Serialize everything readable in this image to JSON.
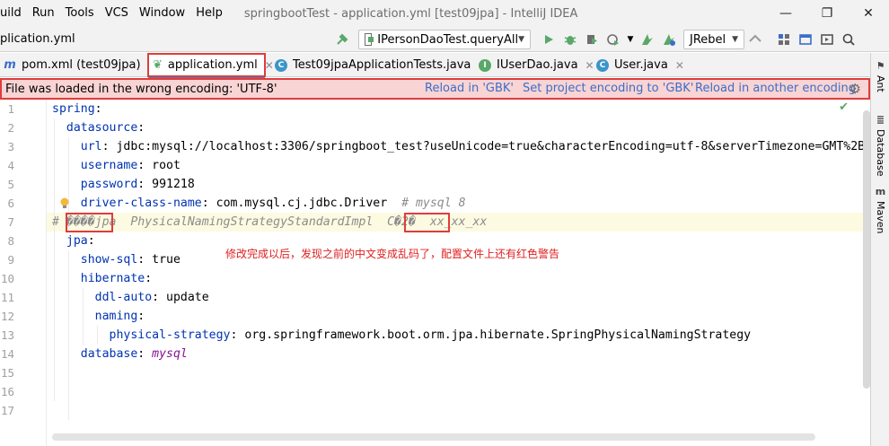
{
  "window": {
    "title": "springbootTest - application.yml [test09jpa] - IntelliJ IDEA",
    "controls": [
      "—",
      "❐",
      "✕"
    ]
  },
  "menu": [
    "uild",
    "Run",
    "Tools",
    "VCS",
    "Window",
    "Help"
  ],
  "breadcrumb": "plication.yml",
  "toolbar": {
    "run_config": "IPersonDaoTest.queryAll",
    "jrebel": "JRebel"
  },
  "tabs": [
    {
      "label": "pom.xml (test09jpa)",
      "icon": "maven-icon",
      "icon_char": "m",
      "icon_color": "#3c6ec8",
      "active": false
    },
    {
      "label": "application.yml",
      "icon": "spring-leaf-icon",
      "icon_char": "❦",
      "icon_color": "#59a869",
      "active": true
    },
    {
      "label": "Test09jpaApplicationTests.java",
      "icon": "class-icon",
      "icon_char": "C",
      "icon_color": "#3a95c9",
      "active": false
    },
    {
      "label": "IUserDao.java",
      "icon": "interface-icon",
      "icon_char": "I",
      "icon_color": "#59a869",
      "active": false
    },
    {
      "label": "User.java",
      "icon": "class-icon",
      "icon_char": "C",
      "icon_color": "#3a95c9",
      "active": false
    }
  ],
  "banner": {
    "message": "File was loaded in the wrong encoding: 'UTF-8'",
    "actions": [
      "Reload in 'GBK'",
      "Set project encoding to 'GBK'",
      "Reload in another encoding"
    ]
  },
  "right_tools": [
    "Ant",
    "Database",
    "Maven"
  ],
  "editor": {
    "line_numbers": [
      "1",
      "2",
      "3",
      "4",
      "5",
      "6",
      "7",
      "8",
      "9",
      "10",
      "11",
      "12",
      "13",
      "14",
      "15",
      "16",
      "17"
    ],
    "lines": [
      {
        "key": "spring",
        "sep": ":",
        "val": "",
        "comment": ""
      },
      {
        "key": "  datasource",
        "sep": ":",
        "val": "",
        "comment": ""
      },
      {
        "key": "    url",
        "sep": ": ",
        "val": "jdbc:mysql://localhost:3306/springboot_test?useUnicode=true&characterEncoding=utf-8&serverTimezone=GMT%2B",
        "comment": ""
      },
      {
        "key": "    username",
        "sep": ": ",
        "val": "root",
        "comment": ""
      },
      {
        "key": "    password",
        "sep": ": ",
        "val": "991218",
        "comment": ""
      },
      {
        "key": "    driver-class-name",
        "sep": ": ",
        "val": "com.mysql.cj.jdbc.Driver",
        "comment": "  # mysql 8"
      },
      {
        "key": "",
        "sep": "",
        "val": "",
        "comment": "# ����jpa  PhysicalNamingStrategyStandardImpl  C�2�  xx_xx_xx"
      },
      {
        "key": "  jpa",
        "sep": ":",
        "val": "",
        "comment": ""
      },
      {
        "key": "    show-sql",
        "sep": ": ",
        "val": "true",
        "comment": ""
      },
      {
        "key": "    hibernate",
        "sep": ":",
        "val": "",
        "comment": ""
      },
      {
        "key": "      ddl-auto",
        "sep": ": ",
        "val": "update",
        "comment": ""
      },
      {
        "key": "      naming",
        "sep": ":",
        "val": "",
        "comment": ""
      },
      {
        "key": "        physical-strategy",
        "sep": ": ",
        "val": "org.springframework.boot.orm.jpa.hibernate.SpringPhysicalNamingStrategy",
        "comment": ""
      },
      {
        "key": "    database",
        "sep": ": ",
        "val": "",
        "vital": "mysql",
        "comment": ""
      },
      {
        "key": "",
        "sep": "",
        "val": "",
        "comment": ""
      },
      {
        "key": "",
        "sep": "",
        "val": "",
        "comment": ""
      },
      {
        "key": "",
        "sep": "",
        "val": "",
        "comment": ""
      }
    ]
  },
  "annotation": "修改完成以后，发现之前的中文变成乱码了，配置文件上还有红色警告",
  "colors": {
    "accent": "#4083c9",
    "warning_bg": "#f8d4d4",
    "highlight_box": "#e03c3c",
    "yaml_key": "#0033b3",
    "comment": "#8c8c8c"
  }
}
